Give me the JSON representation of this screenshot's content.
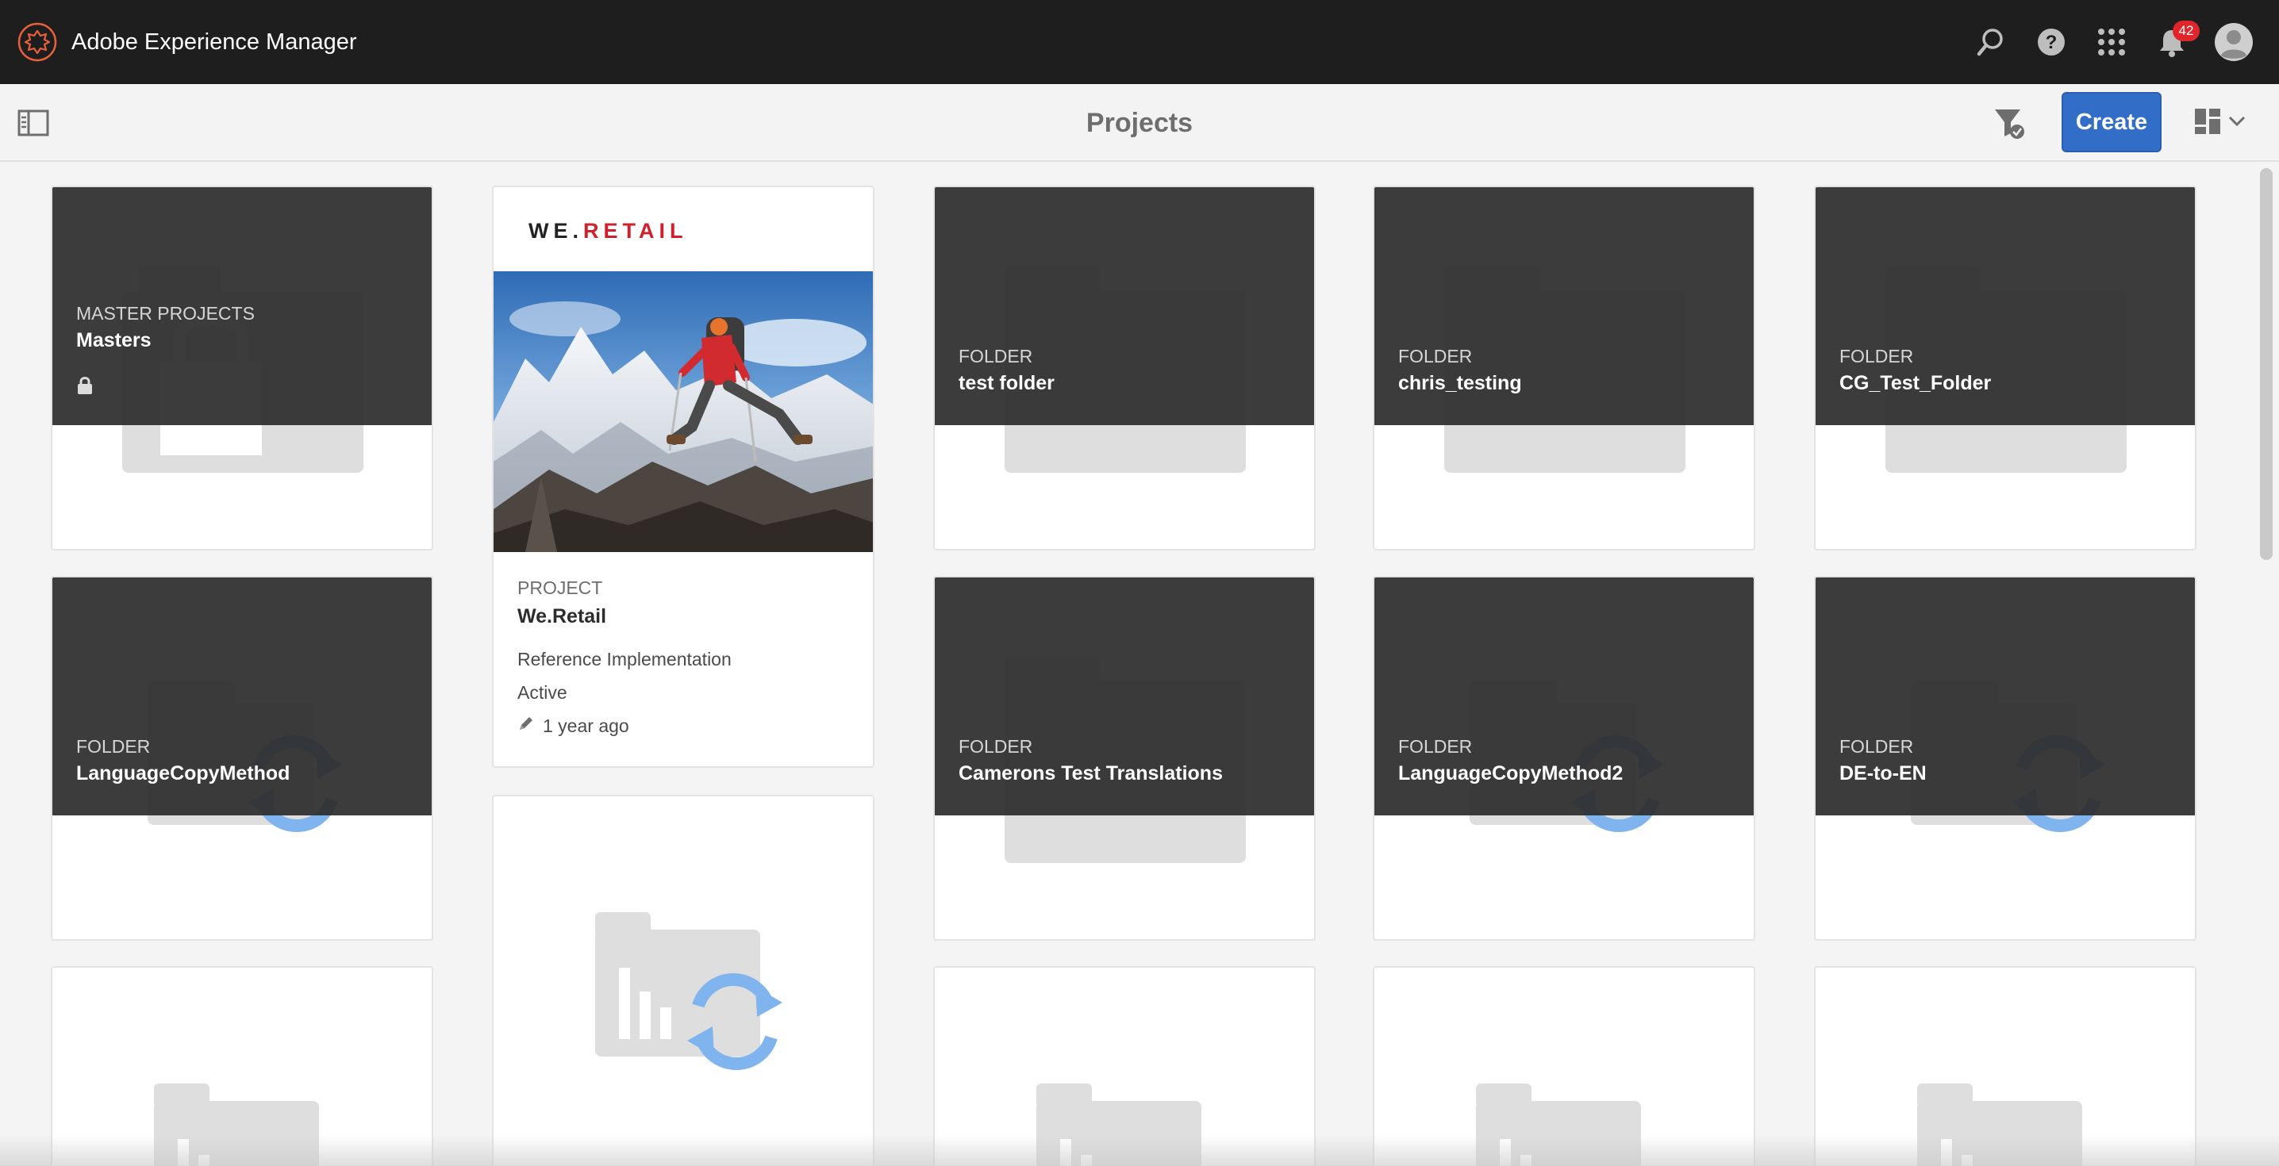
{
  "header": {
    "app_title": "Adobe Experience Manager",
    "notification_count": "42",
    "icons": [
      "adobe-logo-icon",
      "search-icon",
      "help-icon",
      "apps-grid-icon",
      "bell-icon",
      "user-avatar-icon"
    ]
  },
  "action_bar": {
    "title": "Projects",
    "create_label": "Create"
  },
  "colors": {
    "header_bg": "#1e1e1e",
    "create_button": "#326ec8",
    "badge": "#e0262b",
    "card_overlay": "#323232",
    "sync_icon": "#7fb4ee"
  },
  "cards": {
    "masters": {
      "type": "MASTER PROJECTS",
      "name": "Masters"
    },
    "test_folder": {
      "type": "FOLDER",
      "name": "test folder"
    },
    "chris_testing": {
      "type": "FOLDER",
      "name": "chris_testing"
    },
    "cg_test_folder": {
      "type": "FOLDER",
      "name": "CG_Test_Folder"
    },
    "language_copy_method": {
      "type": "FOLDER",
      "name": "LanguageCopyMethod"
    },
    "camerons": {
      "type": "FOLDER",
      "name": "Camerons Test Translations"
    },
    "language_copy_method2": {
      "type": "FOLDER",
      "name": "LanguageCopyMethod2"
    },
    "de_to_en": {
      "type": "FOLDER",
      "name": "DE-to-EN"
    }
  },
  "project_card": {
    "brand_we": "WE.",
    "brand_retail": "RETAIL",
    "type": "PROJECT",
    "name": "We.Retail",
    "description": "Reference Implementation",
    "status": "Active",
    "modified": "1 year ago"
  }
}
